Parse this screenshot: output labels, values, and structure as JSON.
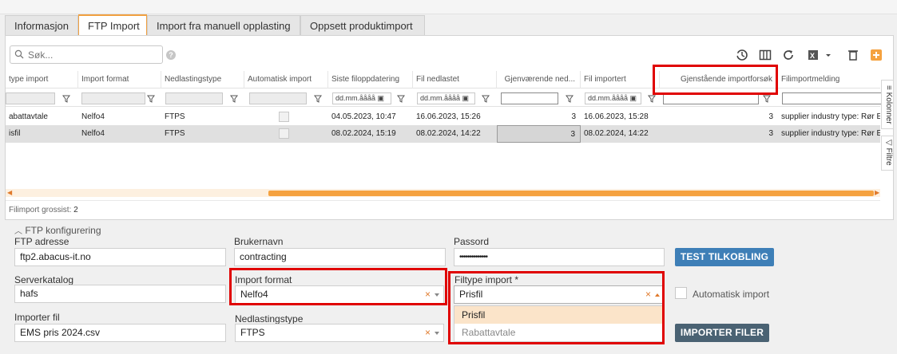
{
  "tabs": [
    {
      "label": "Informasjon"
    },
    {
      "label": "FTP Import"
    },
    {
      "label": "Import fra manuell opplasting"
    },
    {
      "label": "Oppsett produktimport"
    }
  ],
  "toolbar": {
    "search_placeholder": "Søk...",
    "help_label": "?",
    "icons": [
      "history-icon",
      "columns-icon",
      "refresh-icon",
      "excel-export-icon",
      "trash-icon",
      "add-icon"
    ]
  },
  "grid": {
    "columns": [
      "type import",
      "Import format",
      "Nedlastingstype",
      "Automatisk import",
      "Siste filoppdatering",
      "Fil nedlastet",
      "Gjenværende ned...",
      "Fil importert",
      "Gjenstående importforsøk",
      "Filimportmelding"
    ],
    "date_placeholder": "dd.mm.åååå",
    "rows": [
      {
        "type": "abattavtale",
        "format": "Nelfo4",
        "nedlasting": "FTPS",
        "siste": "04.05.2023, 10:47",
        "nedlastet": "16.06.2023, 15:26",
        "gjenv": "3",
        "importert": "16.06.2023, 15:28",
        "forsok": "3",
        "melding": "supplier industry type: Rør E..."
      },
      {
        "type": "isfil",
        "format": "Nelfo4",
        "nedlasting": "FTPS",
        "siste": "08.02.2024, 15:19",
        "nedlastet": "08.02.2024, 14:22",
        "gjenv": "3",
        "importert": "08.02.2024, 14:22",
        "forsok": "3",
        "melding": "supplier industry type: Rør E..."
      }
    ],
    "footer_label": "Filimport grossist:",
    "footer_count": "2",
    "side_columns_label": "Kolonner",
    "side_filter_label": "Filtre"
  },
  "config": {
    "section_title": "FTP konfigurering",
    "ftp_label": "FTP adresse",
    "ftp_value": "ftp2.abacus-it.no",
    "user_label": "Brukernavn",
    "user_value": "contracting",
    "pass_label": "Passord",
    "pass_value": "••••••••••••••",
    "test_button": "TEST TILKOBLING",
    "server_label": "Serverkatalog",
    "server_value": "hafs",
    "format_label": "Import format",
    "format_value": "Nelfo4",
    "filtype_label": "Filtype import *",
    "filtype_value": "Prisfil",
    "filtype_options": [
      "Prisfil",
      "Rabattavtale"
    ],
    "auto_label": "Automatisk import",
    "importfil_label": "Importer fil",
    "importfil_value": "EMS pris 2024.csv",
    "nedlasting_label": "Nedlastingstype",
    "nedlasting_value": "FTPS",
    "import_button": "IMPORTER FILER",
    "clear_glyph": "×"
  },
  "colors": {
    "accent": "#f5a240",
    "button": "#3e7fb7",
    "button_dark": "#4a6273",
    "highlight": "#e00000"
  }
}
